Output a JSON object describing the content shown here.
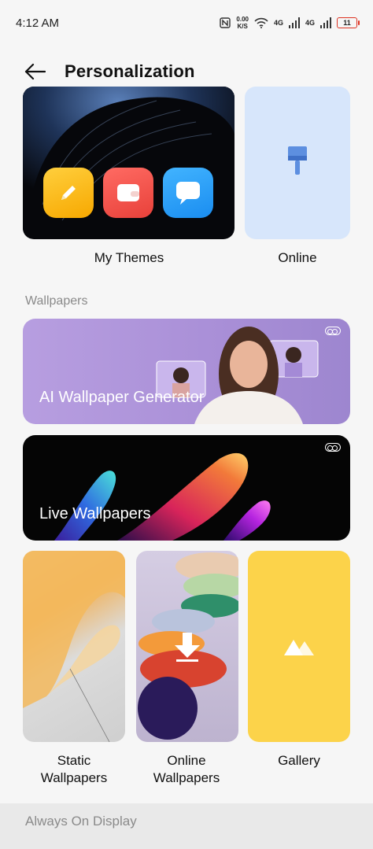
{
  "status_bar": {
    "time": "4:12 AM",
    "net_speed_value": "0.00",
    "net_speed_unit": "K/S",
    "signal1_label": "4G",
    "signal2_label": "4G",
    "battery_level": "11"
  },
  "header": {
    "title": "Personalization"
  },
  "themes": {
    "my_themes_label": "My Themes",
    "online_label": "Online"
  },
  "wallpapers": {
    "section_label": "Wallpapers",
    "ai_label": "AI Wallpaper Generator",
    "live_label": "Live Wallpapers",
    "tiles": [
      {
        "label_line1": "Static",
        "label_line2": "Wallpapers"
      },
      {
        "label_line1": "Online",
        "label_line2": "Wallpapers"
      },
      {
        "label_line1": "Gallery",
        "label_line2": ""
      }
    ]
  },
  "aod": {
    "label": "Always On Display"
  },
  "colors": {
    "online_card_bg": "#d7e6fb",
    "ai_banner_bg": "#b79ee0",
    "gallery_bg": "#fcd34a"
  },
  "icons": [
    "nfc-icon",
    "wifi-icon",
    "signal-icon",
    "battery-icon",
    "back-arrow-icon",
    "paint-brush-icon",
    "notes-icon",
    "wallet-icon",
    "message-icon",
    "toggle-icon",
    "download-icon",
    "gallery-mountains-icon"
  ]
}
